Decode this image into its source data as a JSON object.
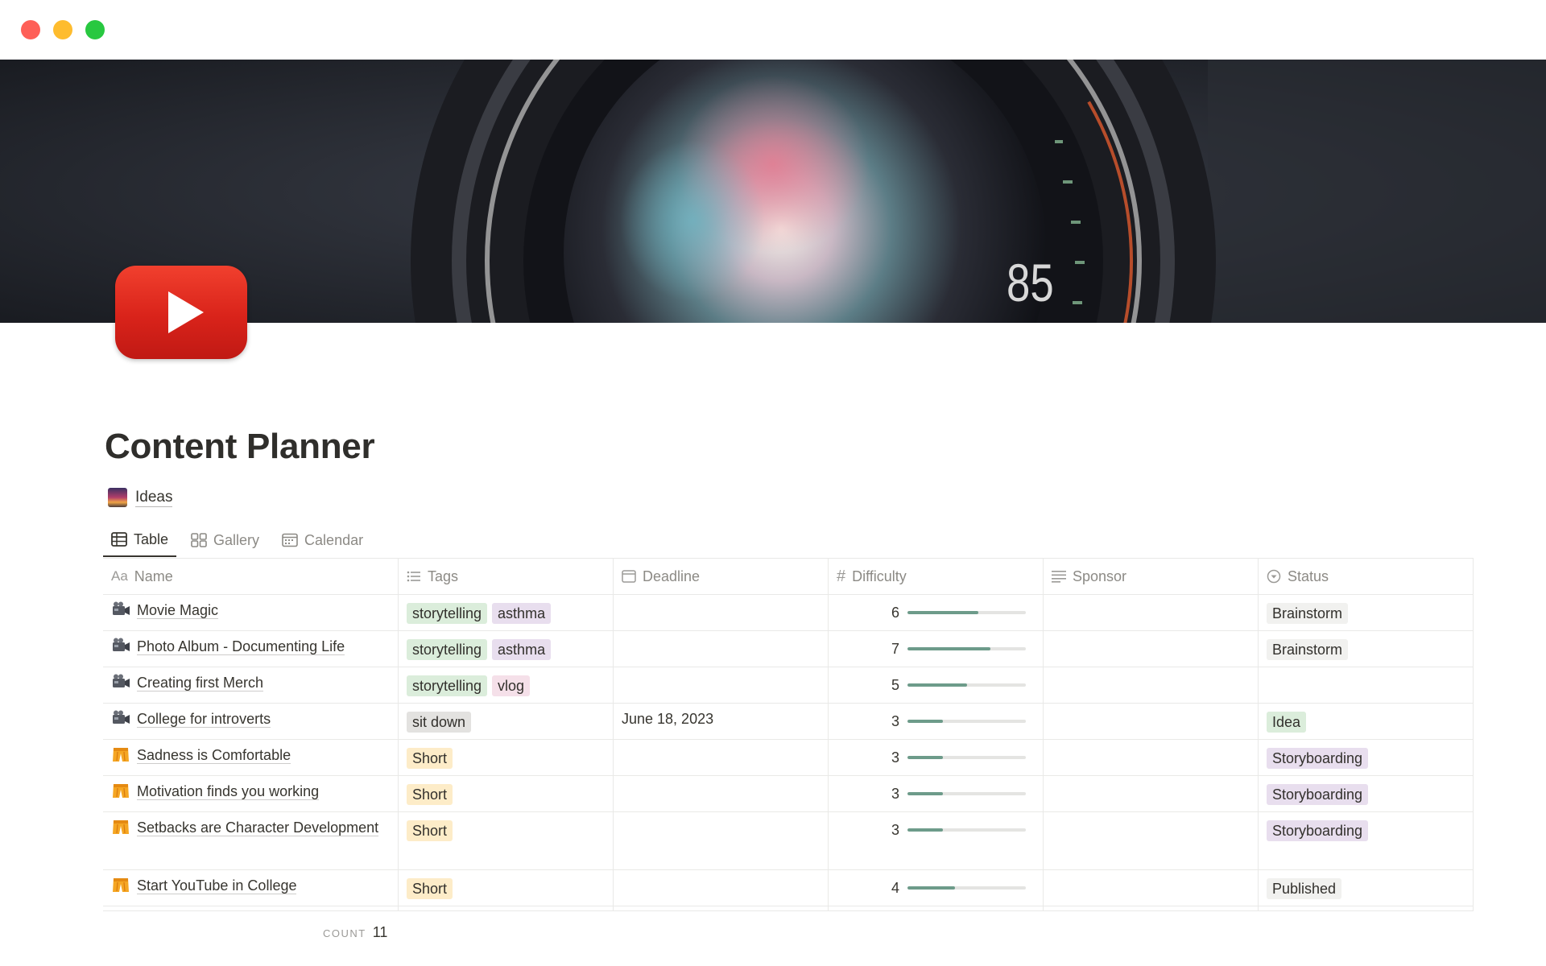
{
  "window": {
    "buttons": [
      "close",
      "minimize",
      "maximize"
    ]
  },
  "cover": {
    "description_icon": "camera-lens-cover-image",
    "lens_text": "85"
  },
  "page": {
    "icon": "youtube-play-icon",
    "title": "Content Planner",
    "linked_db": {
      "icon": "sunrise-emoji",
      "label": "Ideas"
    }
  },
  "tabs": [
    {
      "label": "Table",
      "icon": "table-icon",
      "active": true
    },
    {
      "label": "Gallery",
      "icon": "gallery-icon",
      "active": false
    },
    {
      "label": "Calendar",
      "icon": "calendar-icon",
      "active": false
    }
  ],
  "columns": [
    {
      "label": "Name",
      "icon": "Aa"
    },
    {
      "label": "Tags",
      "icon": "list-icon"
    },
    {
      "label": "Deadline",
      "icon": "calendar-icon"
    },
    {
      "label": "Difficulty",
      "icon": "#"
    },
    {
      "label": "Sponsor",
      "icon": "text-icon"
    },
    {
      "label": "Status",
      "icon": "status-icon"
    }
  ],
  "rows": [
    {
      "emoji": "video-camera",
      "name": "Movie Magic",
      "tags": [
        {
          "t": "storytelling",
          "c": "green"
        },
        {
          "t": "asthma",
          "c": "purple"
        }
      ],
      "deadline": "",
      "difficulty": 6,
      "sponsor": "",
      "status": {
        "t": "Brainstorm",
        "c": "gray"
      }
    },
    {
      "emoji": "video-camera",
      "name": "Photo Album - Documenting Life",
      "tags": [
        {
          "t": "storytelling",
          "c": "green"
        },
        {
          "t": "asthma",
          "c": "purple"
        }
      ],
      "deadline": "",
      "difficulty": 7,
      "sponsor": "",
      "status": {
        "t": "Brainstorm",
        "c": "gray"
      }
    },
    {
      "emoji": "video-camera",
      "name": "Creating first Merch",
      "tags": [
        {
          "t": "storytelling",
          "c": "green"
        },
        {
          "t": "vlog",
          "c": "pink"
        }
      ],
      "deadline": "",
      "difficulty": 5,
      "sponsor": "",
      "status": null
    },
    {
      "emoji": "video-camera",
      "name": "College for introverts",
      "tags": [
        {
          "t": "sit down",
          "c": "gray"
        }
      ],
      "deadline": "June 18, 2023",
      "difficulty": 3,
      "sponsor": "",
      "status": {
        "t": "Idea",
        "c": "green"
      }
    },
    {
      "emoji": "shorts",
      "name": "Sadness is Comfortable",
      "tags": [
        {
          "t": "Short",
          "c": "orange"
        }
      ],
      "deadline": "",
      "difficulty": 3,
      "sponsor": "",
      "status": {
        "t": "Storyboarding",
        "c": "purple"
      }
    },
    {
      "emoji": "shorts",
      "name": "Motivation finds you working",
      "tags": [
        {
          "t": "Short",
          "c": "orange"
        }
      ],
      "deadline": "",
      "difficulty": 3,
      "sponsor": "",
      "status": {
        "t": "Storyboarding",
        "c": "purple"
      }
    },
    {
      "emoji": "shorts",
      "name": "Setbacks are Character Development",
      "tags": [
        {
          "t": "Short",
          "c": "orange"
        }
      ],
      "deadline": "",
      "difficulty": 3,
      "sponsor": "",
      "status": {
        "t": "Storyboarding",
        "c": "purple"
      }
    },
    {
      "emoji": "shorts",
      "name": "Start YouTube in College",
      "tags": [
        {
          "t": "Short",
          "c": "orange"
        }
      ],
      "deadline": "",
      "difficulty": 4,
      "sponsor": "",
      "status": {
        "t": "Published",
        "c": "blue"
      }
    }
  ],
  "difficulty_max": 10,
  "footer": {
    "count_label": "COUNT",
    "count_value": "11"
  },
  "colors": {
    "bar_fill": "#6d9b8a",
    "youtube_red": "#e0261c"
  }
}
